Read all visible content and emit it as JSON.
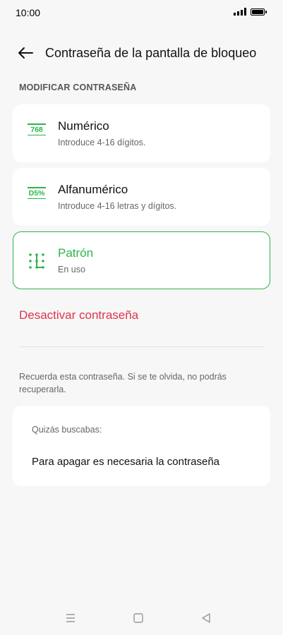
{
  "status_bar": {
    "time": "10:00"
  },
  "header": {
    "title": "Contraseña de la pantalla de bloqueo"
  },
  "section_label": "MODIFICAR CONTRASEÑA",
  "options": [
    {
      "icon_text": "768",
      "title": "Numérico",
      "subtitle": "Introduce 4-16 dígitos."
    },
    {
      "icon_text": "D5%",
      "title": "Alfanumérico",
      "subtitle": "Introduce 4-16 letras y dígitos."
    },
    {
      "title": "Patrón",
      "subtitle": "En uso"
    }
  ],
  "disable_label": "Desactivar contraseña",
  "note": "Recuerda esta contraseña. Si se te olvida, no podrás recuperarla.",
  "suggest": {
    "label": "Quizás buscabas:",
    "item": "Para apagar es necesaria la contraseña"
  },
  "colors": {
    "accent": "#2db44b",
    "danger": "#e0344a",
    "background": "#f7f7f7"
  }
}
